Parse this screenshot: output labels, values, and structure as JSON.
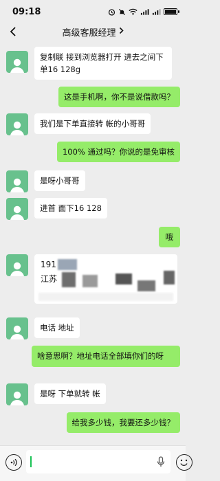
{
  "status": {
    "time": "09:18"
  },
  "nav": {
    "title": "高级客服经理"
  },
  "messages": [
    {
      "text": "复制联 接到浏览器打开 进去之间下单16 128g"
    },
    {
      "text": "这是手机啊，你不是说借款吗？"
    },
    {
      "text": "我们是下单直接转 帐的小哥哥"
    },
    {
      "text": "100% 通过吗？你说的是免审核"
    },
    {
      "text": "是呀小哥哥"
    },
    {
      "text": "进首 面下16 128"
    },
    {
      "text": "哦"
    },
    {
      "text": "电话 地址"
    },
    {
      "text": "啥意思啊？地址电话全部填你们的呀"
    },
    {
      "text": "是呀 下单就转 帐"
    },
    {
      "text": "给我多少钱，我要还多少钱？"
    }
  ],
  "card": {
    "line1": "191",
    "line2": "江苏"
  },
  "colors": {
    "incoming": "#ffffff",
    "outgoing": "#95ec69",
    "background": "#ededed",
    "avatar": "#68c18d"
  }
}
